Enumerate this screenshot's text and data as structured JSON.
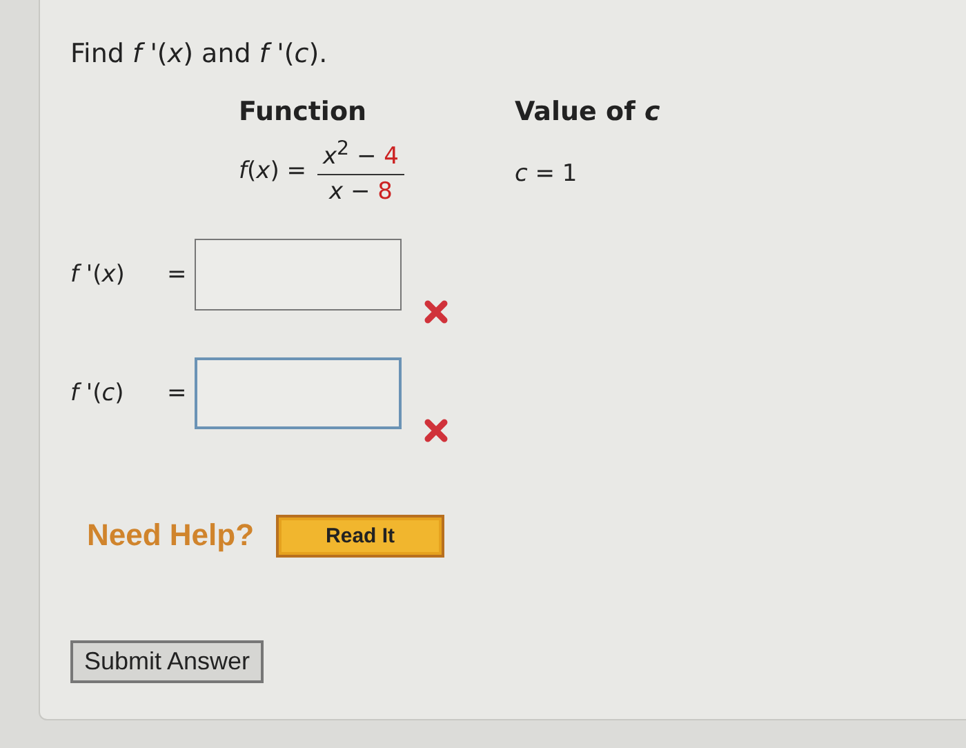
{
  "question": {
    "prompt": "Find *f* '(*x*) and *f* '(*c*).",
    "headers": [
      "Function",
      "Value of *c*"
    ],
    "function": {
      "lhs": "*f*(*x*) =",
      "numerator_expr": "*x*$^{2}$ −",
      "numerator_const": "4",
      "denominator_expr": "*x* −",
      "denominator_const": "8"
    },
    "value_of_c": "*c* = 1",
    "answers": [
      {
        "label": "*f* '(*x*)",
        "equals": "=",
        "focused": false,
        "correct": false
      },
      {
        "label": "*f* '(*c*)",
        "equals": "=",
        "focused": true,
        "correct": false
      }
    ],
    "help": {
      "label": "Need Help?",
      "button": "Read It"
    },
    "submit": "Submit Answer"
  }
}
